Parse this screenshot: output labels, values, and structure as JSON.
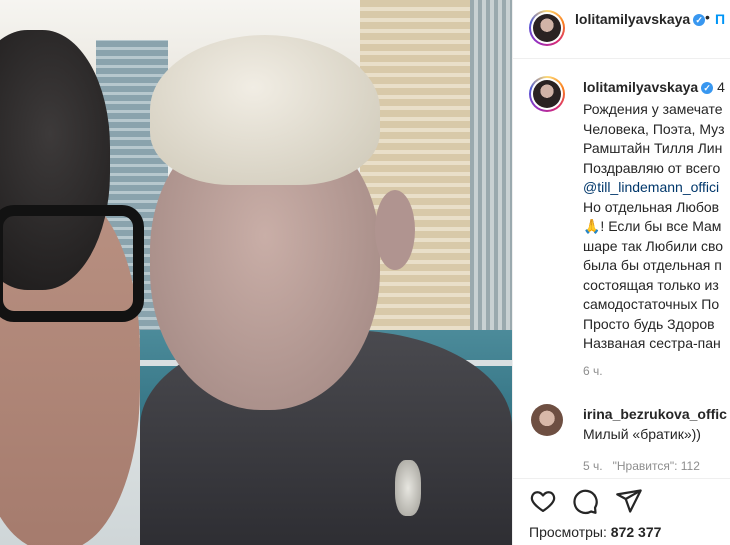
{
  "header": {
    "username": "lolitamilyavskaya",
    "separator": "•",
    "follow_label": "П"
  },
  "caption": {
    "username": "lolitamilyavskaya",
    "username_trail": "4",
    "lines": [
      "Рождения у замечате",
      "Человека, Поэта, Муз",
      "Рамштайн Тилля Лин",
      "Поздравляю от всего",
      "@till_lindemann_offici",
      "Но отдельная Любов",
      "🙏! Если бы все Мам",
      "шаре так Любили сво",
      "была бы отдельная п",
      "состоящая только из",
      "самодостаточных По",
      "Просто будь Здоров",
      "Названая сестра-пан"
    ],
    "time": "6 ч."
  },
  "comment": {
    "username": "irina_bezrukova_offic",
    "text": "Милый «братик»))",
    "time": "5 ч.",
    "likes": "\"Нравится\": 112"
  },
  "actions": {
    "like_icon": "heart-icon",
    "comment_icon": "comment-bubble-icon",
    "share_icon": "paper-plane-icon",
    "views_label": "Просмотры:",
    "views_count": "872 377"
  },
  "colors": {
    "link": "#0095f6",
    "mention": "#00376b",
    "muted": "#8e8e8e",
    "verified": "#3897f0"
  }
}
